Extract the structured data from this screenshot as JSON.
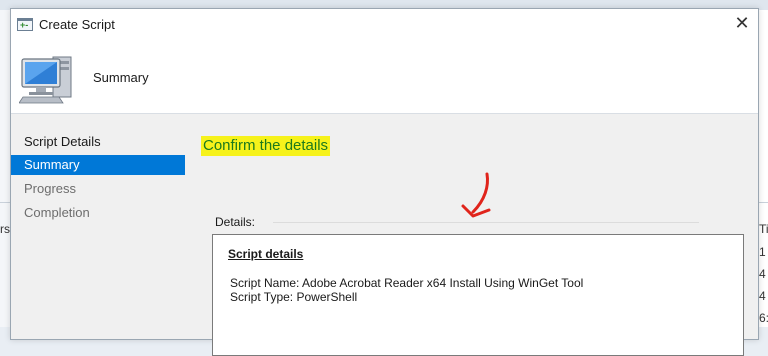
{
  "dialog": {
    "title": "Create Script",
    "close_glyph": "✕",
    "header_title": "Summary"
  },
  "nav": {
    "items": [
      {
        "label": "Script Details",
        "state": "done"
      },
      {
        "label": "Summary",
        "state": "active"
      },
      {
        "label": "Progress",
        "state": "pending"
      },
      {
        "label": "Completion",
        "state": "pending"
      }
    ]
  },
  "content": {
    "heading": "Confirm the details",
    "details_label": "Details:",
    "box_heading": "Script details",
    "lines": [
      "Script Name: Adobe Acrobat Reader x64 Install Using WinGet Tool",
      "Script Type: PowerShell"
    ]
  },
  "background": {
    "left_fragment": "rs",
    "right_fragments": [
      "Ti",
      "1",
      "4",
      "4",
      "6:"
    ]
  },
  "colors": {
    "accent": "#0078d7",
    "highlight": "#f6f21b",
    "heading_text": "#1c7a1c",
    "annotation_arrow": "#e0241b"
  },
  "icons": {
    "title_icon": "script-window-icon",
    "header_icon": "computer-icon",
    "close": "close-icon"
  }
}
